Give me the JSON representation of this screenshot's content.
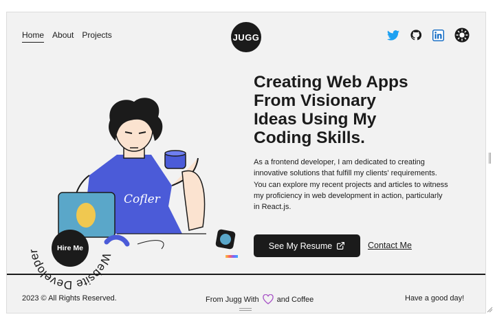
{
  "nav": {
    "items": [
      {
        "label": "Home"
      },
      {
        "label": "About"
      },
      {
        "label": "Projects"
      }
    ]
  },
  "logo": {
    "text": "JUGG"
  },
  "social": {
    "twitter_color": "#1da1f2",
    "linkedin_color": "#0a66c2"
  },
  "hero": {
    "title_lines": [
      "Creating Web Apps",
      "From Visionary",
      "Ideas Using My",
      "Coding Skills."
    ],
    "description": "As a frontend developer, I am dedicated to creating innovative solutions that fulfill my clients' requirements. You can explore my recent projects and articles to witness my proficiency in web development in action, particularly in React.js.",
    "resume_button": "See My Resume",
    "contact_link": "Contact Me"
  },
  "illustration": {
    "shirt_text": "Cofler"
  },
  "hire": {
    "button": "Hire Me",
    "circle_text": "Website Developer."
  },
  "footer": {
    "copyright": "2023 © All Rights Reserved.",
    "made_prefix": "From Jugg With",
    "made_suffix": "and Coffee",
    "greeting": "Have a good day!"
  },
  "colors": {
    "dark": "#1b1b1b",
    "background": "#f2f2f2",
    "heart": "#a855c7",
    "shirt": "#4b5bd8",
    "laptop": "#5aa7c9"
  }
}
